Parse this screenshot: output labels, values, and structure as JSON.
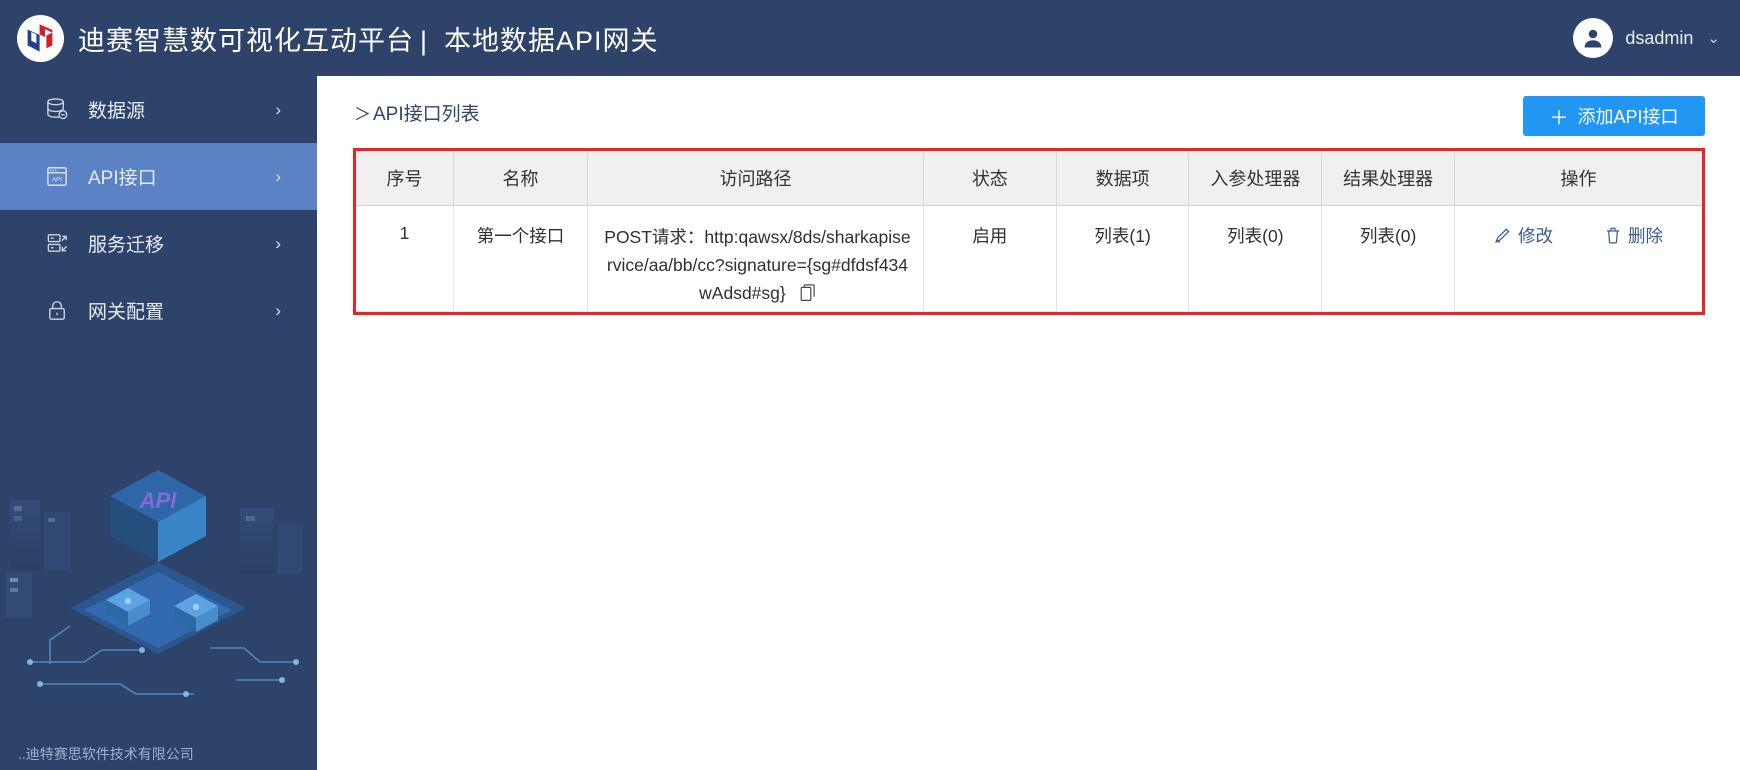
{
  "header": {
    "logo_icon": "cube-logo-icon",
    "title_main": "迪赛智慧数可视化互动平台",
    "separator": "|",
    "title_sub": "本地数据API网关",
    "avatar_icon": "user-avatar-icon",
    "user_name": "dsadmin",
    "chevron": "⌄"
  },
  "sidebar": {
    "items": [
      {
        "label": "数据源",
        "icon": "database-icon",
        "chevron": "›",
        "active": false
      },
      {
        "label": "API接口",
        "icon": "api-window-icon",
        "chevron": "›",
        "active": true
      },
      {
        "label": "服务迁移",
        "icon": "server-migrate-icon",
        "chevron": "›",
        "active": false
      },
      {
        "label": "网关配置",
        "icon": "lock-icon",
        "chevron": "›",
        "active": false
      }
    ],
    "art_icon": "isometric-api-illustration",
    "footer_text": "..迪特赛思软件技术有限公司"
  },
  "main": {
    "breadcrumb_chevron": "＞",
    "breadcrumb": "API接口列表",
    "add_button": {
      "plus": "＋",
      "label": "添加API接口"
    },
    "table": {
      "highlight_color": "#ee2222",
      "columns": [
        "序号",
        "名称",
        "访问路径",
        "状态",
        "数据项",
        "入参处理器",
        "结果处理器",
        "操作"
      ],
      "rows": [
        {
          "index": "1",
          "name": "第一个接口",
          "path": "POST请求：http:qawsx/8ds/sharkapiservice/aa/bb/cc?signature={sg#dfdsf434wAdsd#sg}",
          "copy_icon": "copy-icon",
          "state": "启用",
          "data_item": "列表(1)",
          "in_handler": "列表(0)",
          "out_handler": "列表(0)",
          "edit": {
            "icon": "pencil-icon",
            "label": "修改"
          },
          "delete": {
            "icon": "trash-icon",
            "label": "删除"
          }
        }
      ]
    }
  },
  "colors": {
    "header_bg": "#2e4369",
    "sidebar_active": "#5b82c4",
    "primary_button": "#2196f3",
    "link": "#3d5a8c",
    "table_header_bg": "#f0f0f0"
  }
}
